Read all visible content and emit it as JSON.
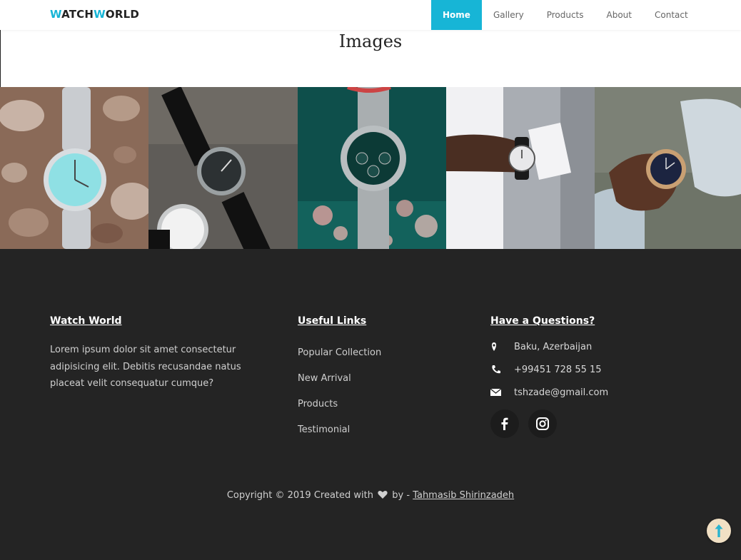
{
  "header": {
    "logo_part1_accent": "W",
    "logo_part1_rest": "ATCH",
    "logo_part2_accent": "W",
    "logo_part2_rest": "ORLD",
    "nav": [
      "Home",
      "Gallery",
      "Products",
      "About",
      "Contact"
    ],
    "active_nav": "Home"
  },
  "images_section": {
    "title": "Images",
    "tiles": [
      "watch on pebbles",
      "two watches on stone",
      "steel chronograph with bokeh",
      "man adjusting watch",
      "hand holding watch"
    ]
  },
  "footer": {
    "about": {
      "title": "Watch World",
      "text": "Lorem ipsum dolor sit amet consectetur adipisicing elit. Debitis recusandae natus placeat velit consequatur cumque?"
    },
    "links": {
      "title": "Useful Links",
      "items": [
        "Popular Collection",
        "New Arrival",
        "Products",
        "Testimonial"
      ]
    },
    "contact": {
      "title": "Have a Questions?",
      "address": "Baku, Azerbaijan",
      "phone": "+99451 728 55 15",
      "email": "tshzade@gmail.com",
      "socials": [
        "facebook-icon",
        "instagram-icon"
      ]
    },
    "copyright_prefix": "Copyright © 2019 Created with",
    "copyright_by": "by -",
    "copyright_author": "Tahmasib Shirinzadeh"
  },
  "colors": {
    "accent": "#17b5d6",
    "footer_bg": "#242424",
    "back_to_top_bg": "#f1e0c4"
  }
}
